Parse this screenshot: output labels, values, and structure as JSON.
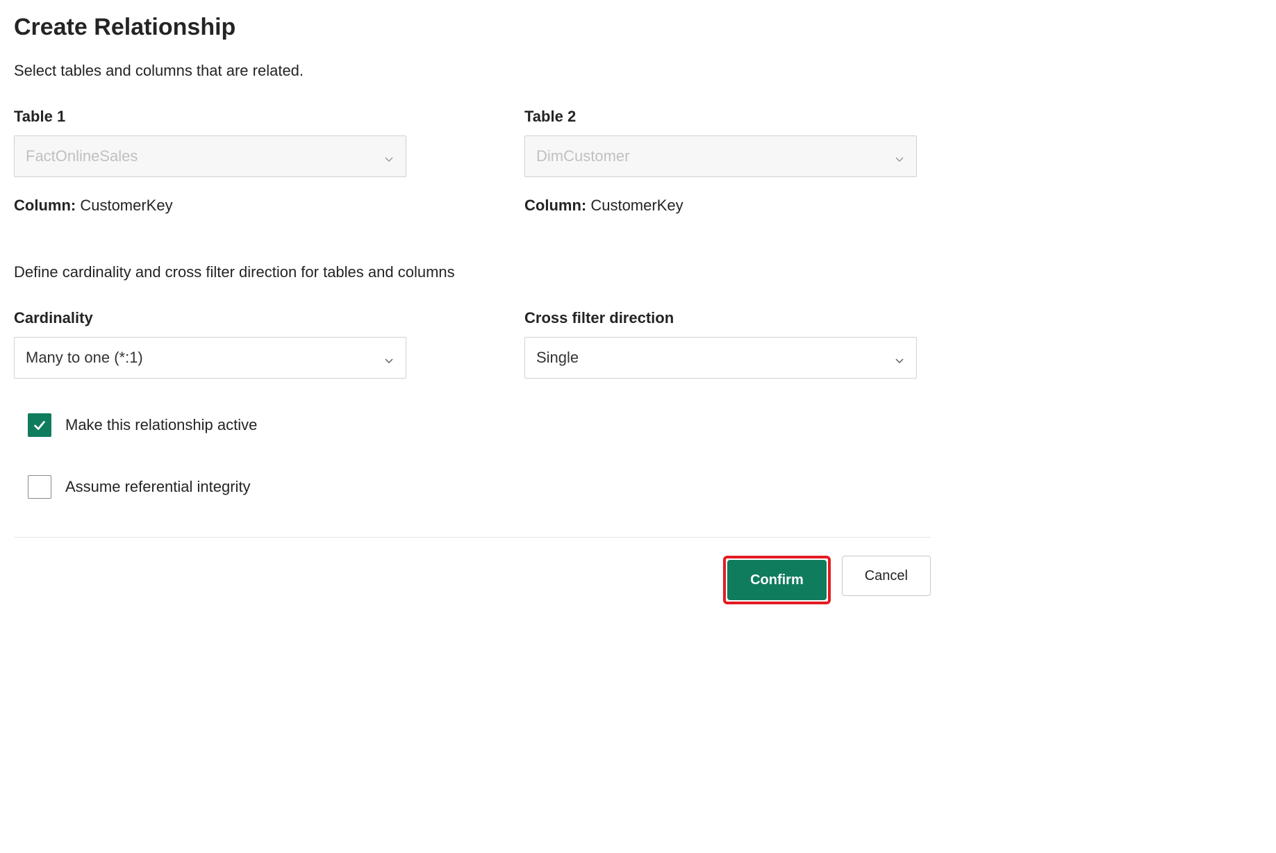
{
  "dialog": {
    "title": "Create Relationship",
    "subtitle": "Select tables and columns that are related."
  },
  "table1": {
    "label": "Table 1",
    "value": "FactOnlineSales",
    "columnLabel": "Column:",
    "columnValue": "CustomerKey"
  },
  "table2": {
    "label": "Table 2",
    "value": "DimCustomer",
    "columnLabel": "Column:",
    "columnValue": "CustomerKey"
  },
  "cardinalitySection": {
    "subtitle": "Define cardinality and cross filter direction for tables and columns"
  },
  "cardinality": {
    "label": "Cardinality",
    "value": "Many to one (*:1)"
  },
  "crossFilter": {
    "label": "Cross filter direction",
    "value": "Single"
  },
  "checkboxes": {
    "activeLabel": "Make this relationship active",
    "activeChecked": true,
    "integrityLabel": "Assume referential integrity",
    "integrityChecked": false
  },
  "buttons": {
    "confirm": "Confirm",
    "cancel": "Cancel"
  }
}
